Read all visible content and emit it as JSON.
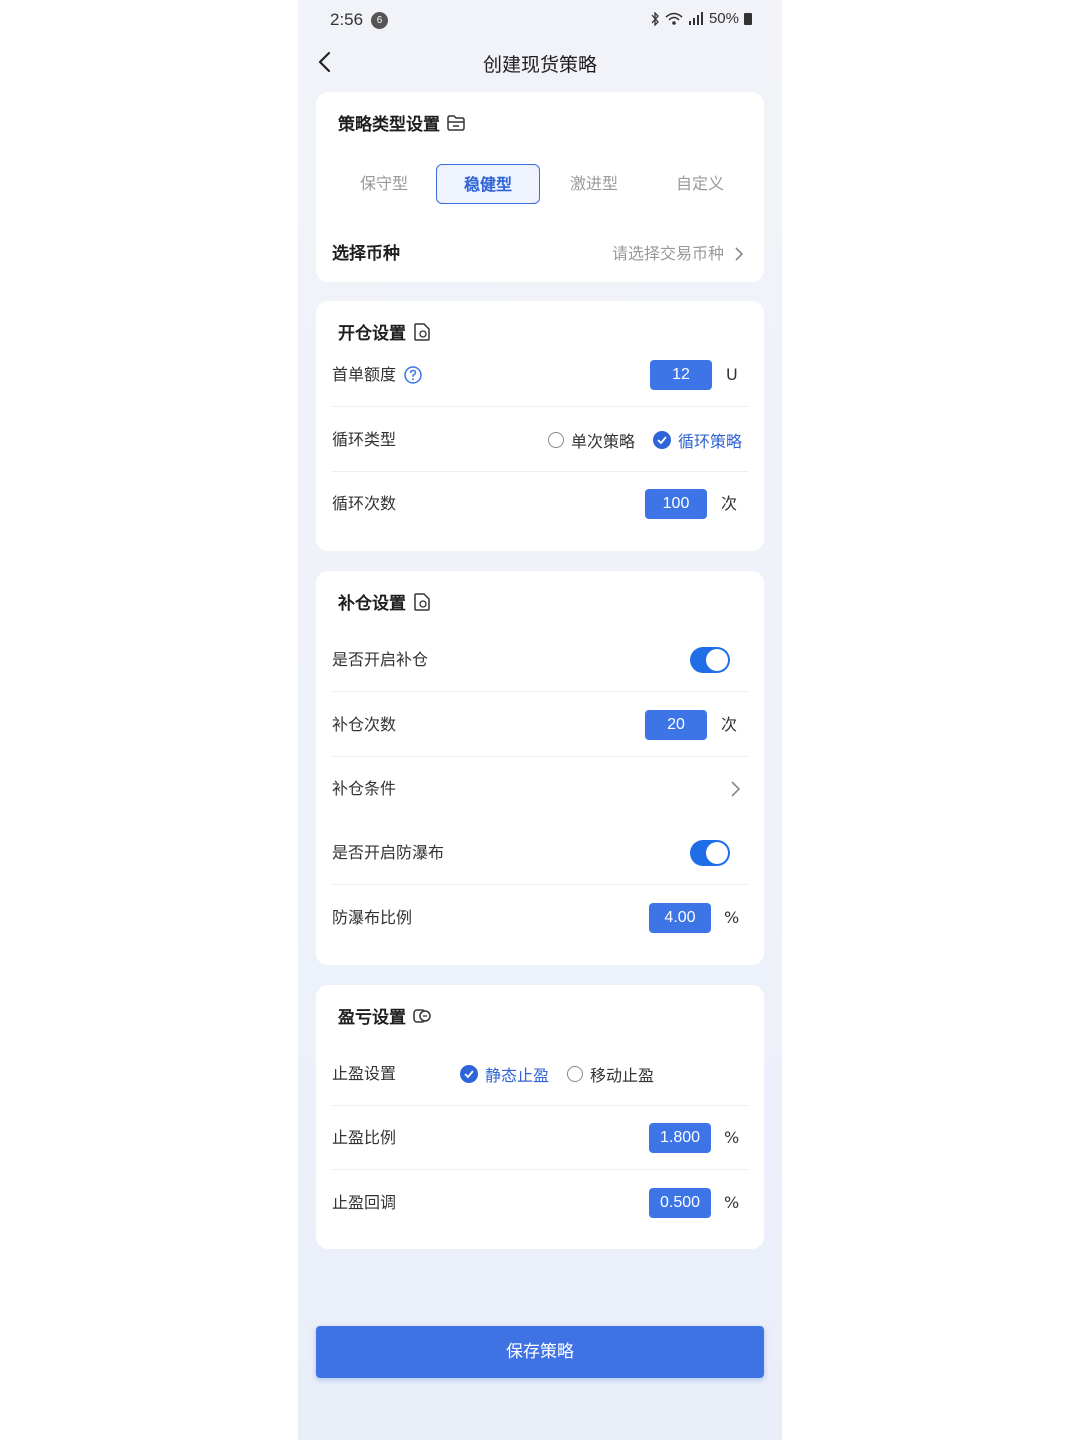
{
  "status_bar": {
    "time": "2:56",
    "notification_count": "6",
    "battery": "50%"
  },
  "nav": {
    "title": "创建现货策略"
  },
  "strategy_type": {
    "title": "策略类型设置",
    "tabs": [
      "保守型",
      "稳健型",
      "激进型",
      "自定义"
    ],
    "active_tab": "稳健型",
    "coin_label": "选择币种",
    "coin_placeholder": "请选择交易币种"
  },
  "open_position": {
    "title": "开仓设置",
    "first_order_label": "首单额度",
    "first_order_value": "12",
    "first_order_unit": "U",
    "cycle_type_label": "循环类型",
    "cycle_options": [
      "单次策略",
      "循环策略"
    ],
    "cycle_selected": "循环策略",
    "cycle_count_label": "循环次数",
    "cycle_count_value": "100",
    "cycle_count_unit": "次"
  },
  "add_position": {
    "title": "补仓设置",
    "enable_label": "是否开启补仓",
    "enable_on": true,
    "count_label": "补仓次数",
    "count_value": "20",
    "count_unit": "次",
    "condition_label": "补仓条件",
    "anti_crash_label": "是否开启防瀑布",
    "anti_crash_on": true,
    "anti_crash_ratio_label": "防瀑布比例",
    "anti_crash_ratio_value": "4.00",
    "anti_crash_ratio_unit": "%"
  },
  "profit_loss": {
    "title": "盈亏设置",
    "take_profit_label": "止盈设置",
    "take_profit_options": [
      "静态止盈",
      "移动止盈"
    ],
    "take_profit_selected": "静态止盈",
    "ratio_label": "止盈比例",
    "ratio_value": "1.800",
    "ratio_unit": "%",
    "pullback_label": "止盈回调",
    "pullback_value": "0.500",
    "pullback_unit": "%"
  },
  "save_button": "保存策略",
  "colors": {
    "accent": "#3d74e6",
    "toggle_on": "#1f6ee8",
    "active_tab_text": "#2f63d8"
  }
}
